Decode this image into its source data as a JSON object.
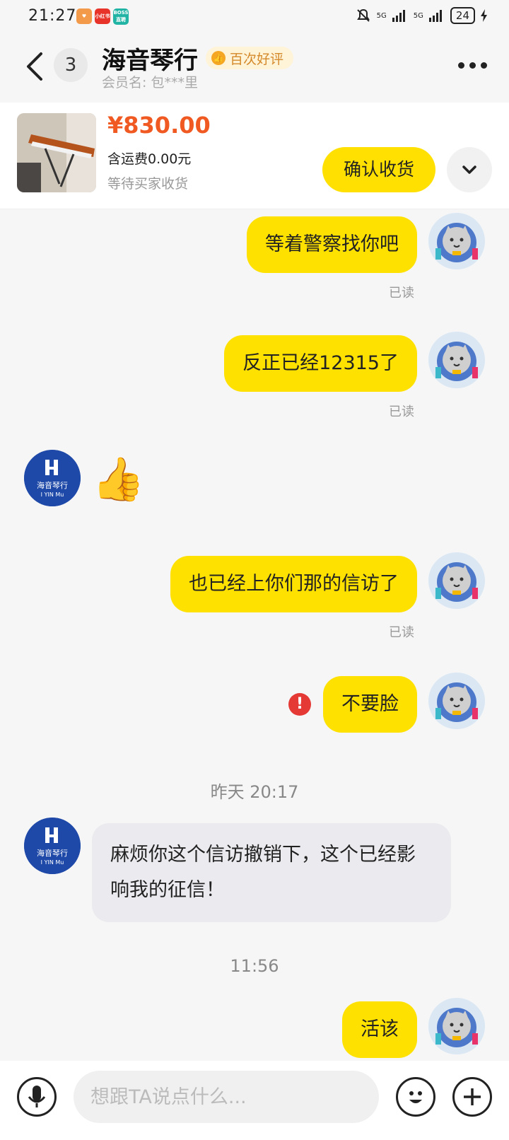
{
  "status_bar": {
    "time": "21:27",
    "apps": [
      {
        "icon": "taobao-app-icon",
        "color": "#f39a4a"
      },
      {
        "icon": "xiaohongshu-app-icon",
        "label": "小红书",
        "color": "#e8332a"
      },
      {
        "icon": "boss-app-icon",
        "label": "BOSS直聘",
        "color": "#21b3a4"
      }
    ],
    "network1": "5G",
    "network2": "5G",
    "battery": "24"
  },
  "header": {
    "unread_count": "3",
    "shop_name": "海音琴行",
    "badge": "百次好评",
    "member_label": "会员名: 包***里"
  },
  "product": {
    "price": "¥830.00",
    "shipping": "含运费0.00元",
    "status": "等待买家收货",
    "confirm_button": "确认收货"
  },
  "messages": [
    {
      "side": "out",
      "text": "等着警察找你吧",
      "read": "已读"
    },
    {
      "side": "out",
      "text": "反正已经12315了",
      "read": "已读"
    },
    {
      "side": "in",
      "type": "emoji",
      "text": "👍"
    },
    {
      "side": "out",
      "text": "也已经上你们那的信访了",
      "read": "已读"
    },
    {
      "side": "out",
      "text": "不要脸",
      "error": "!"
    },
    {
      "type": "time",
      "text": "昨天 20:17"
    },
    {
      "side": "in",
      "text": "麻烦你这个信访撤销下，这个已经影响我的征信！"
    },
    {
      "type": "time",
      "text": "11:56"
    },
    {
      "side": "out",
      "text": "活该"
    }
  ],
  "shop_avatar_text": {
    "line1": "海音琴行",
    "line2": "I YIN Mu"
  },
  "input": {
    "placeholder": "想跟TA说点什么..."
  },
  "colors": {
    "bubble_out": "#ffe100",
    "bubble_in": "#ebebef",
    "price": "#f05a22",
    "accent": "#ffe000"
  }
}
